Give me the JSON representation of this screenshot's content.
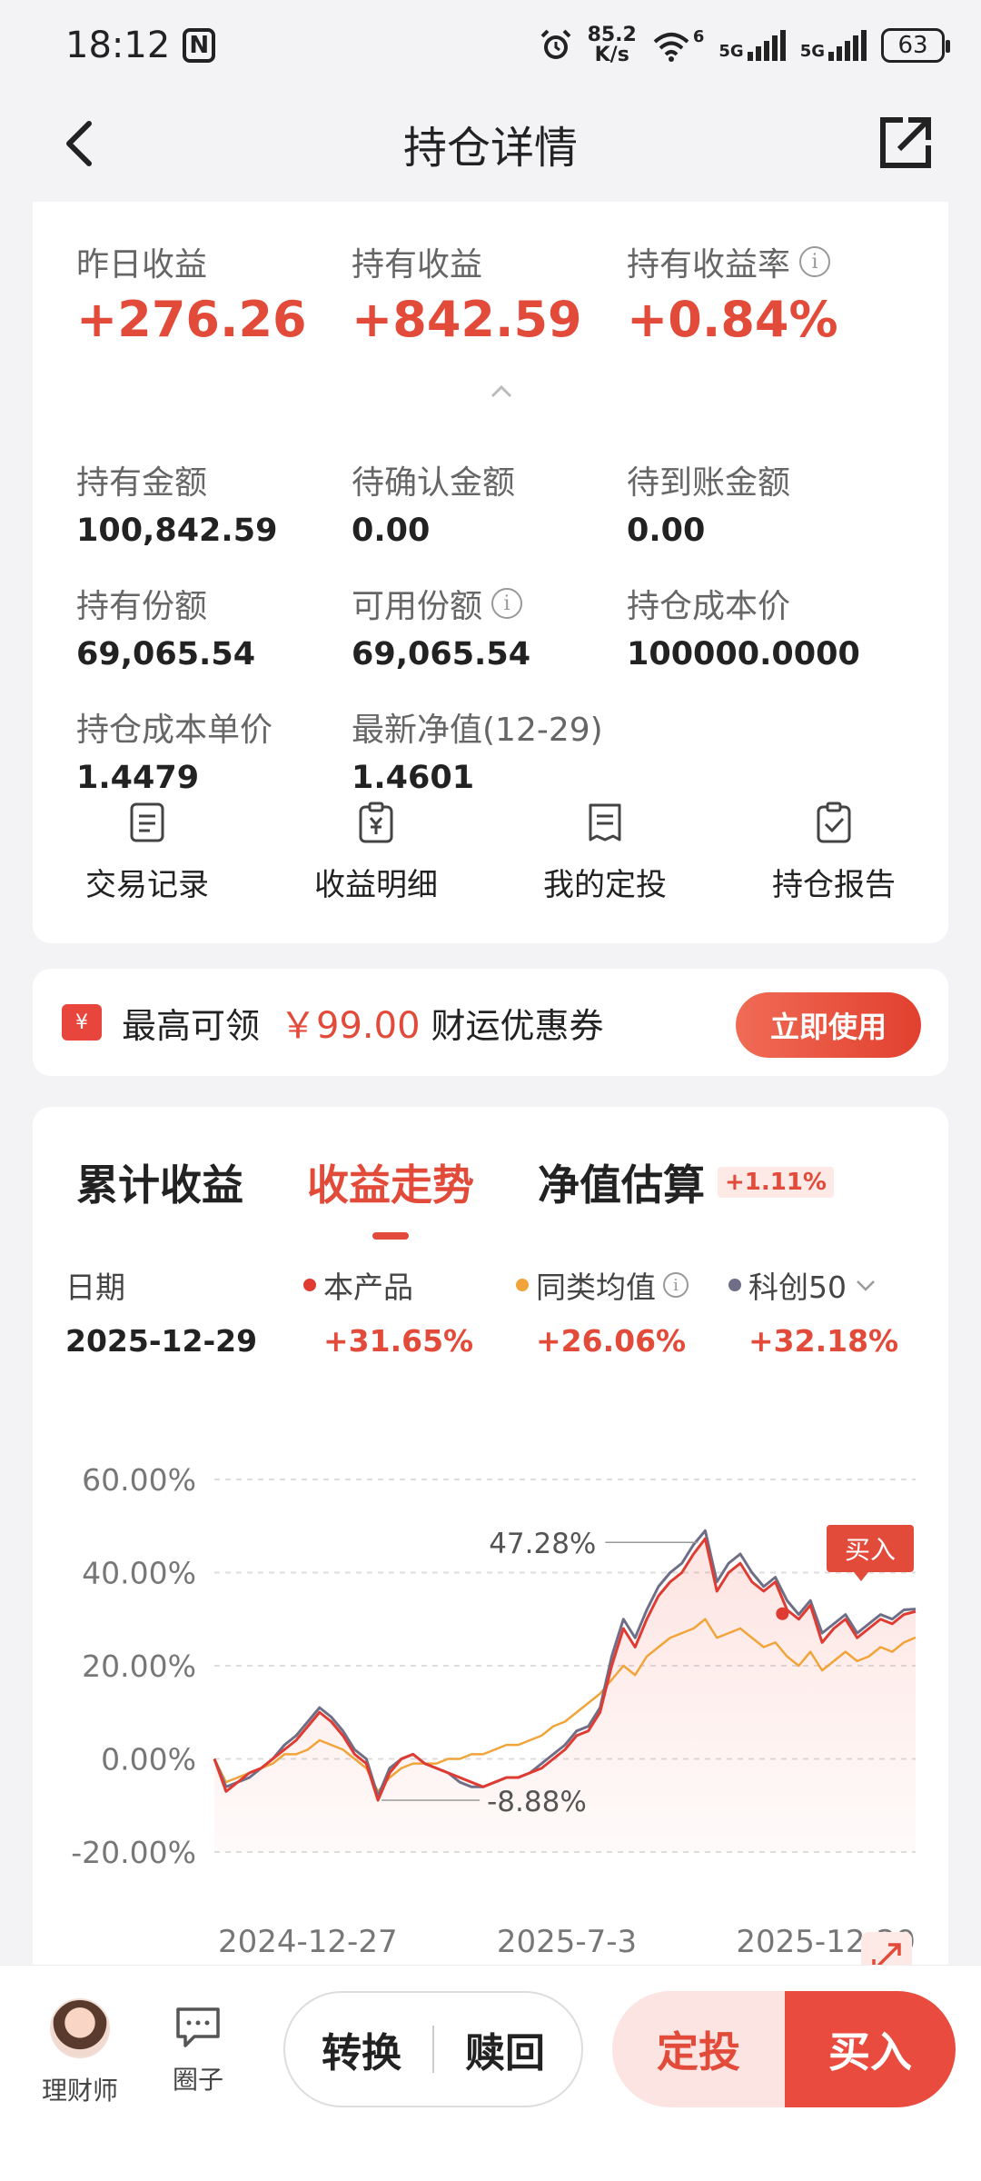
{
  "status_bar": {
    "time": "18:12",
    "net_speed_value": "85.2",
    "net_speed_unit": "K/s",
    "signal_1": "5G",
    "signal_2": "5G",
    "wifi_badge": "6",
    "battery": "63"
  },
  "nav": {
    "title": "持仓详情"
  },
  "summary": {
    "items": [
      {
        "label": "昨日收益",
        "value": "+276.26"
      },
      {
        "label": "持有收益",
        "value": "+842.59"
      },
      {
        "label": "持有收益率",
        "value": "+0.84%"
      }
    ]
  },
  "details": {
    "items": [
      {
        "label": "持有金额",
        "value": "100,842.59"
      },
      {
        "label": "待确认金额",
        "value": "0.00"
      },
      {
        "label": "待到账金额",
        "value": "0.00"
      },
      {
        "label": "持有份额",
        "value": "69,065.54"
      },
      {
        "label": "可用份额",
        "value": "69,065.54"
      },
      {
        "label": "持仓成本价",
        "value": "100000.0000"
      },
      {
        "label": "持仓成本单价",
        "value": "1.4479"
      },
      {
        "label": "最新净值(12-29)",
        "value": "1.4601"
      }
    ]
  },
  "actions": [
    {
      "label": "交易记录",
      "icon": "list-icon"
    },
    {
      "label": "收益明细",
      "icon": "yuan-clipboard-icon"
    },
    {
      "label": "我的定投",
      "icon": "document-icon"
    },
    {
      "label": "持仓报告",
      "icon": "check-clipboard-icon"
    }
  ],
  "coupon": {
    "icon_text": "¥",
    "prefix": "最高可领",
    "amount": "￥99.00",
    "suffix": "财运优惠券",
    "button": "立即使用"
  },
  "chart_tabs": {
    "tabs": [
      "累计收益",
      "收益走势",
      "净值估算"
    ],
    "active_index": 1,
    "badge": "+1.11%"
  },
  "legend": {
    "date_label": "日期",
    "date_value": "2025-12-29",
    "series": [
      {
        "label": "本产品",
        "value": "+31.65%",
        "color": "#e03b32"
      },
      {
        "label": "同类均值",
        "value": "+26.06%",
        "color": "#f0a43a"
      },
      {
        "label": "科创50",
        "value": "+32.18%",
        "color": "#6e6f86"
      }
    ]
  },
  "chart_data": {
    "type": "line",
    "y_ticks": [
      "60.00%",
      "40.00%",
      "20.00%",
      "0.00%",
      "-20.00%"
    ],
    "ylim": [
      -20,
      60
    ],
    "x_tick_labels": [
      "2024-12-27",
      "2025-7-3",
      "2025-12-29"
    ],
    "annotations": {
      "max_label": "47.28%",
      "min_label": "-8.88%",
      "buy_marker": "买入"
    },
    "grid": true,
    "x": [
      0,
      1,
      2,
      3,
      4,
      5,
      6,
      7,
      8,
      9,
      10,
      11,
      12,
      13,
      14,
      15,
      16,
      17,
      18,
      19,
      20,
      21,
      22,
      23,
      24,
      25,
      26,
      27,
      28,
      29,
      30,
      31,
      32,
      33,
      34,
      35,
      36,
      37,
      38,
      39,
      40,
      41,
      42,
      43,
      44,
      45,
      46,
      47,
      48,
      49,
      50,
      51,
      52,
      53,
      54,
      55,
      56,
      57,
      58,
      59,
      60
    ],
    "series": [
      {
        "name": "本产品",
        "color": "#e03b32",
        "values": [
          0,
          -7,
          -5,
          -3,
          -2,
          0,
          2,
          4,
          7,
          10,
          8,
          5,
          1,
          -1,
          -8.88,
          -3,
          0,
          1,
          -1,
          -2,
          -3,
          -4,
          -5,
          -6,
          -5,
          -4,
          -4,
          -3,
          -2,
          0,
          2,
          5,
          6,
          10,
          20,
          28,
          24,
          30,
          35,
          38,
          40,
          44,
          47.28,
          36,
          40,
          42,
          38,
          36,
          38,
          32,
          30,
          33,
          25,
          28,
          30,
          26,
          28,
          30,
          29,
          31,
          31.65
        ]
      },
      {
        "name": "同类均值",
        "color": "#f0a43a",
        "values": [
          0,
          -5,
          -4,
          -3,
          -2,
          -1,
          1,
          1,
          2,
          4,
          3,
          2,
          0,
          -2,
          -7,
          -4,
          -2,
          -1,
          -1,
          -1,
          0,
          0,
          1,
          1,
          2,
          3,
          3,
          4,
          5,
          7,
          8,
          10,
          12,
          14,
          17,
          20,
          18,
          22,
          24,
          26,
          27,
          28,
          30,
          26,
          27,
          28,
          26,
          24,
          25,
          22,
          20,
          23,
          19,
          21,
          23,
          21,
          22,
          24,
          23,
          25,
          26.06
        ]
      },
      {
        "name": "科创50",
        "color": "#6e6f86",
        "values": [
          0,
          -6,
          -5,
          -4,
          -2,
          0,
          3,
          5,
          8,
          11,
          9,
          6,
          2,
          0,
          -8,
          -2,
          0,
          1,
          -1,
          -2,
          -3,
          -5,
          -6,
          -6,
          -5,
          -4,
          -4,
          -3,
          -1,
          1,
          3,
          6,
          7,
          11,
          22,
          30,
          26,
          32,
          37,
          40,
          42,
          46,
          49,
          38,
          42,
          44,
          40,
          37,
          39,
          34,
          31,
          34,
          27,
          29,
          31,
          27,
          29,
          31,
          30,
          32,
          32.18
        ]
      }
    ]
  },
  "bottom": {
    "advisor": "理财师",
    "circle": "圈子",
    "convert": "转换",
    "redeem": "赎回",
    "plan": "定投",
    "buy": "买入"
  }
}
